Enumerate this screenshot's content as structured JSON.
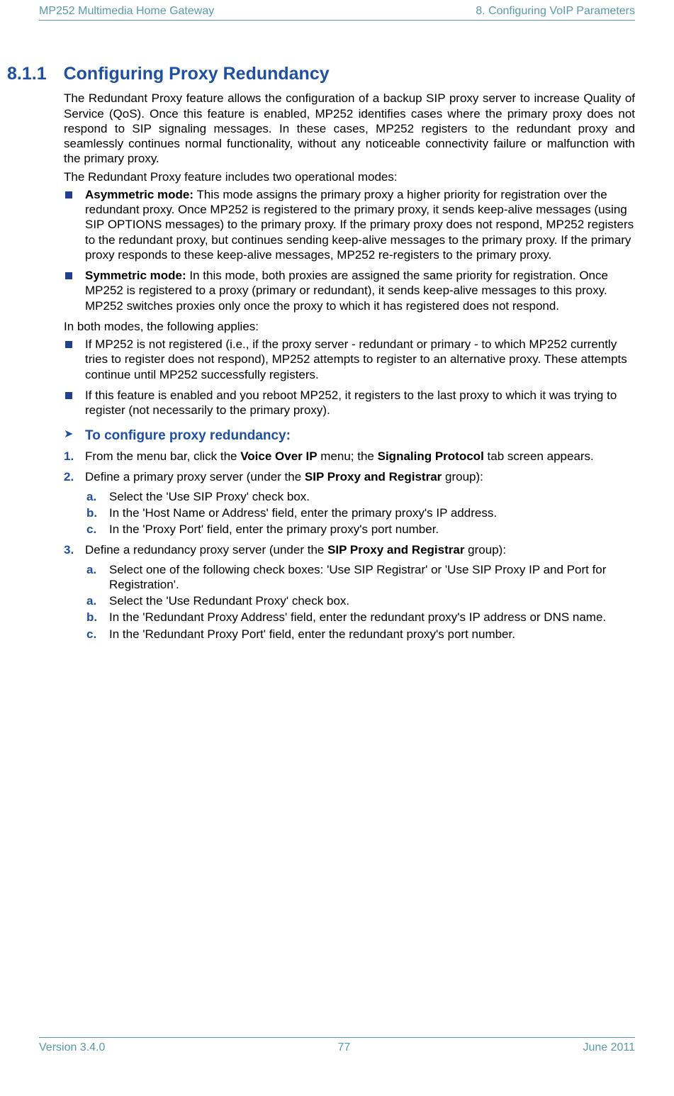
{
  "header": {
    "left": "MP252 Multimedia Home Gateway",
    "right": "8. Configuring VoIP Parameters"
  },
  "section": {
    "number": "8.1.1",
    "title": "Configuring Proxy Redundancy"
  },
  "intro1": "The Redundant Proxy feature allows the configuration of a backup SIP proxy server to increase Quality of Service (QoS). Once this feature is enabled, MP252 identifies cases where the primary proxy does not respond to SIP signaling messages. In these cases, MP252 registers to the redundant proxy and seamlessly continues normal functionality, without any noticeable connectivity failure or malfunction with the primary proxy.",
  "intro2": "The Redundant Proxy feature includes two operational modes:",
  "modes": [
    {
      "label": "Asymmetric mode:",
      "text": " This mode assigns the primary proxy a higher priority for registration over the redundant proxy. Once MP252 is registered to the primary proxy, it sends keep-alive messages (using SIP OPTIONS messages) to the primary proxy. If the primary proxy does not respond, MP252 registers to the redundant proxy, but continues sending keep-alive messages to the primary proxy. If the primary proxy responds to these keep-alive messages, MP252 re-registers to the primary proxy."
    },
    {
      "label": "Symmetric mode:",
      "text": " In this mode, both proxies are assigned the same priority for registration. Once MP252 is registered to a proxy (primary or redundant), it sends keep-alive messages to this proxy. MP252 switches proxies only once the proxy to which it has registered does not respond."
    }
  ],
  "both_intro": "In both modes, the following applies:",
  "both_list": [
    "If MP252 is not registered (i.e., if the proxy server - redundant or primary - to which MP252 currently tries to register does not respond), MP252 attempts to register to an alternative proxy. These attempts continue until MP252 successfully registers.",
    "If this feature is enabled and you reboot MP252, it registers to the last proxy to which it was trying to register (not necessarily to the primary proxy)."
  ],
  "procedure_title": "To configure proxy redundancy:",
  "steps": [
    {
      "num": "1.",
      "pre": "From the menu bar, click the ",
      "bold1": "Voice Over IP",
      "mid": " menu; the ",
      "bold2": "Signaling Protocol",
      "post": " tab screen appears."
    },
    {
      "num": "2.",
      "pre": "Define a primary proxy server (under the ",
      "bold1": "SIP Proxy and Registrar",
      "post": " group):",
      "subs": [
        {
          "letter": "a.",
          "text": "Select the 'Use SIP Proxy' check box."
        },
        {
          "letter": "b.",
          "text": "In the 'Host Name or Address' field, enter the primary proxy's IP address."
        },
        {
          "letter": "c.",
          "text": "In the 'Proxy Port' field, enter the primary proxy's port number."
        }
      ]
    },
    {
      "num": "3.",
      "pre": "Define a redundancy proxy server (under the ",
      "bold1": "SIP Proxy and Registrar",
      "post": " group):",
      "subs": [
        {
          "letter": "a.",
          "text": "Select one of the following check boxes: 'Use SIP Registrar' or 'Use SIP Proxy IP and Port for Registration'."
        },
        {
          "letter": "a.",
          "text": "Select the 'Use Redundant Proxy' check box."
        },
        {
          "letter": "b.",
          "text": "In the 'Redundant Proxy Address' field, enter the redundant proxy's IP address or DNS name."
        },
        {
          "letter": "c.",
          "text": "In the 'Redundant Proxy Port' field, enter the redundant proxy's port number."
        }
      ]
    }
  ],
  "footer": {
    "left": "Version 3.4.0",
    "center": "77",
    "right": "June 2011"
  }
}
